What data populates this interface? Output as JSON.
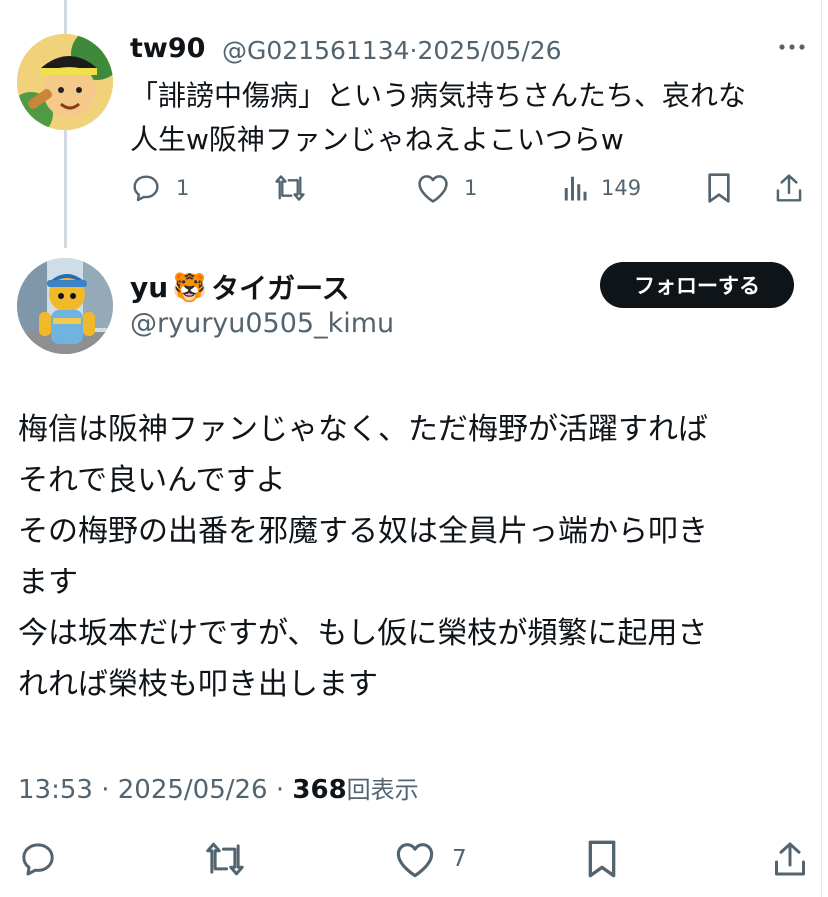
{
  "reply_tweet": {
    "display_name": "tw90",
    "handle": "@G021561134",
    "separator": "·",
    "date": "2025/05/26",
    "body": "「誹謗中傷病」という病気持ちさんたち、哀れな\n人生w阪神ファンじゃねえよこいつらw",
    "actions": {
      "reply_count": "1",
      "retweet_count": "",
      "like_count": "1",
      "view_count": "149"
    },
    "icons": [
      "more-icon",
      "reply-icon",
      "retweet-icon",
      "like-icon",
      "views-icon",
      "bookmark-icon",
      "share-icon"
    ]
  },
  "main_tweet": {
    "display_name": "yu",
    "name_emoji": "🐯",
    "display_name_suffix": "タイガース",
    "handle": "@ryuryu0505_kimu",
    "follow_label": "フォローする",
    "body": "梅信は阪神ファンじゃなく、ただ梅野が活躍すれば\nそれで良いんですよ\nその梅野の出番を邪魔する奴は全員片っ端から叩き\nます\n今は坂本だけですが、もし仮に榮枝が頻繁に起用さ\nれれば榮枝も叩き出します",
    "time": "13:53",
    "separator": "·",
    "date": "2025/05/26",
    "views": "368",
    "views_label": "回表示",
    "actions": {
      "reply_count": "",
      "retweet_count": "",
      "like_count": "7"
    },
    "icons": [
      "reply-icon",
      "retweet-icon",
      "like-icon",
      "bookmark-icon",
      "share-icon"
    ]
  },
  "colors": {
    "text": "#0f1419",
    "secondary_text": "#536471",
    "thread_line": "#cfd9de",
    "follow_button_bg": "#0f1419",
    "follow_button_text": "#ffffff"
  }
}
